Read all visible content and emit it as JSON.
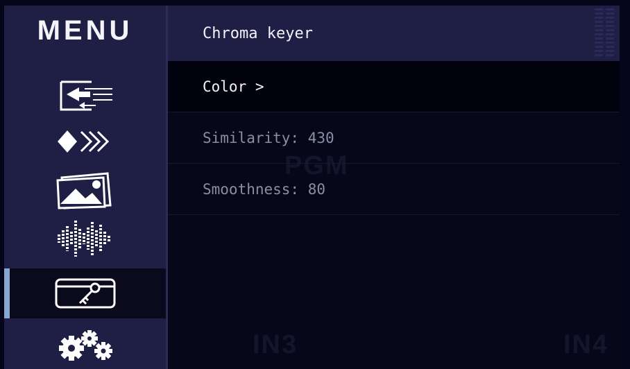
{
  "sidebar": {
    "title": "MENU",
    "items": [
      {
        "icon": "input-switch-icon",
        "active": false
      },
      {
        "icon": "transition-icon",
        "active": false
      },
      {
        "icon": "image-gallery-icon",
        "active": false
      },
      {
        "icon": "audio-waveform-icon",
        "active": false
      },
      {
        "icon": "key-card-icon",
        "active": true
      },
      {
        "icon": "settings-gears-icon",
        "active": false
      }
    ]
  },
  "panel": {
    "title": "Chroma keyer",
    "rows": [
      {
        "label": "Color >",
        "state": "selected"
      },
      {
        "label": "Similarity: 430",
        "state": "dim"
      },
      {
        "label": "Smoothness: 80",
        "state": "dim"
      }
    ]
  },
  "background_labels": [
    "PGM",
    "IN3",
    "IN4"
  ],
  "colors": {
    "sidebar_bg": "#1f1e45",
    "panel_bg": "#07071a",
    "accent": "#8aa7cf",
    "text": "#f3f3f8",
    "text_dim": "#8a8fa3"
  }
}
